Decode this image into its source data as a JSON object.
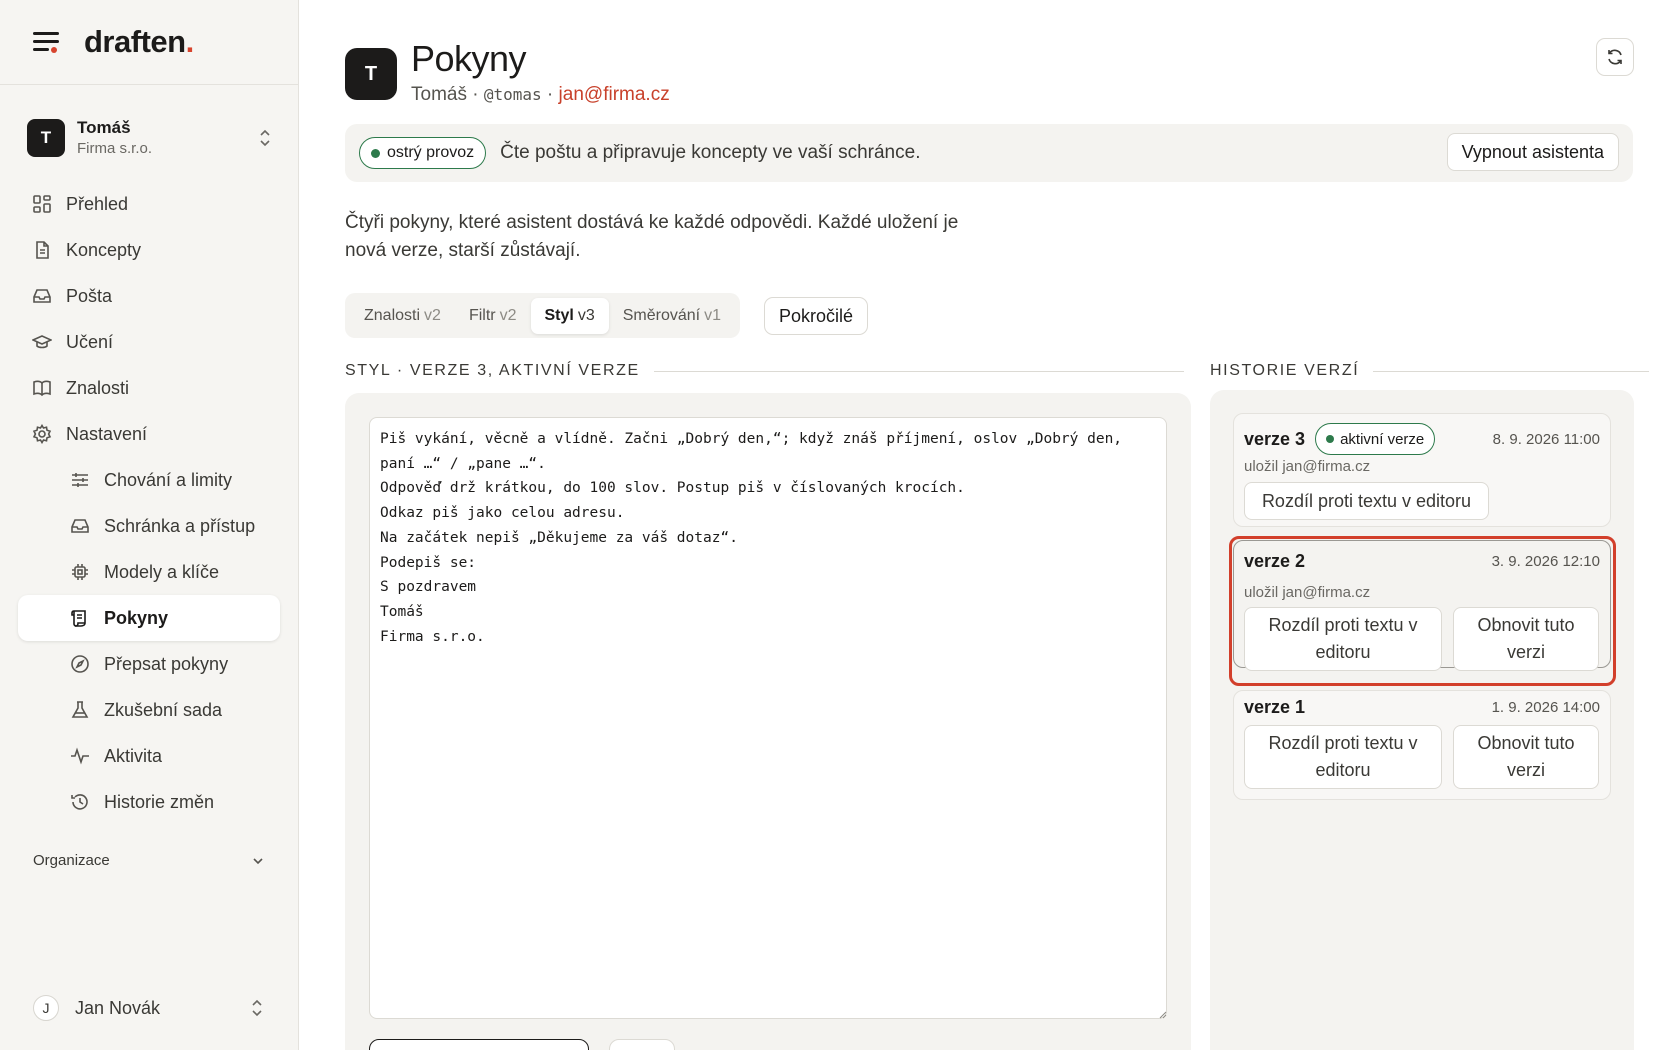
{
  "brand": {
    "name": "draften",
    "accent": "."
  },
  "account": {
    "avatar": "T",
    "name": "Tomáš",
    "org": "Firma s.r.o."
  },
  "nav": [
    {
      "label": "Přehled",
      "icon": "grid-icon"
    },
    {
      "label": "Koncepty",
      "icon": "document-icon"
    },
    {
      "label": "Pošta",
      "icon": "inbox-icon"
    },
    {
      "label": "Učení",
      "icon": "graduation-cap-icon"
    },
    {
      "label": "Znalosti",
      "icon": "book-icon"
    },
    {
      "label": "Nastavení",
      "icon": "gear-icon"
    }
  ],
  "subnav": [
    {
      "label": "Chování a limity",
      "icon": "sliders-icon"
    },
    {
      "label": "Schránka a přístup",
      "icon": "inbox-icon"
    },
    {
      "label": "Modely a klíče",
      "icon": "chip-icon"
    },
    {
      "label": "Pokyny",
      "icon": "scroll-icon",
      "active": true
    },
    {
      "label": "Přepsat pokyny",
      "icon": "compass-icon"
    },
    {
      "label": "Zkušební sada",
      "icon": "flask-icon"
    },
    {
      "label": "Aktivita",
      "icon": "activity-icon"
    },
    {
      "label": "Historie změn",
      "icon": "history-icon"
    }
  ],
  "org_section": "Organizace",
  "user": {
    "initial": "J",
    "name": "Jan Novák"
  },
  "header": {
    "avatar": "T",
    "title": "Pokyny",
    "sub_name": "Tomáš",
    "sep": " · ",
    "handle": "@tomas",
    "email": "jan@firma.cz"
  },
  "banner": {
    "badge": "ostrý provoz",
    "text": "Čte poštu a připravuje koncepty ve vaší schránce.",
    "button": "Vypnout asistenta"
  },
  "intro": "Čtyři pokyny, které asistent dostává ke každé odpovědi. Každé uložení je nová verze, starší zůstávají.",
  "tabs": [
    {
      "label": "Znalosti",
      "ver": "v2"
    },
    {
      "label": "Filtr",
      "ver": "v2"
    },
    {
      "label": "Styl",
      "ver": "v3",
      "active": true
    },
    {
      "label": "Směrování",
      "ver": "v1"
    }
  ],
  "advanced_button": "Pokročilé",
  "editor": {
    "heading": "STYL · VERZE 3, AKTIVNÍ VERZE",
    "text": "Piš vykání, věcně a vlídně. Začni „Dobrý den,“; když znáš příjmení, oslov „Dobrý den,\npaní …“ / „pane …“.\nOdpověď drž krátkou, do 100 slov. Postup piš v číslovaných krocích.\nOdkaz piš jako celou adresu.\nNa začátek nepiš „Děkujeme za váš dotaz“.\nPodepiš se:\nS pozdravem\nTomáš\nFirma s.r.o."
  },
  "history": {
    "heading": "HISTORIE VERZÍ",
    "versions": [
      {
        "title": "verze 3",
        "badge": "aktivní verze",
        "date": "8. 9. 2026 11:00",
        "by": "uložil jan@firma.cz",
        "diff": "Rozdíl proti textu v editoru"
      },
      {
        "title": "verze 2",
        "date": "3. 9. 2026 12:10",
        "by": "uložil jan@firma.cz",
        "diff": "Rozdíl proti textu v editoru",
        "restore": "Obnovit tuto verzi"
      },
      {
        "title": "verze 1",
        "date": "1. 9. 2026 14:00",
        "diff": "Rozdíl proti textu v editoru",
        "restore": "Obnovit tuto verzi"
      }
    ]
  },
  "colors": {
    "accent": "#d7442e",
    "success": "#2d7a4b",
    "highlight": "#d23f2b"
  }
}
